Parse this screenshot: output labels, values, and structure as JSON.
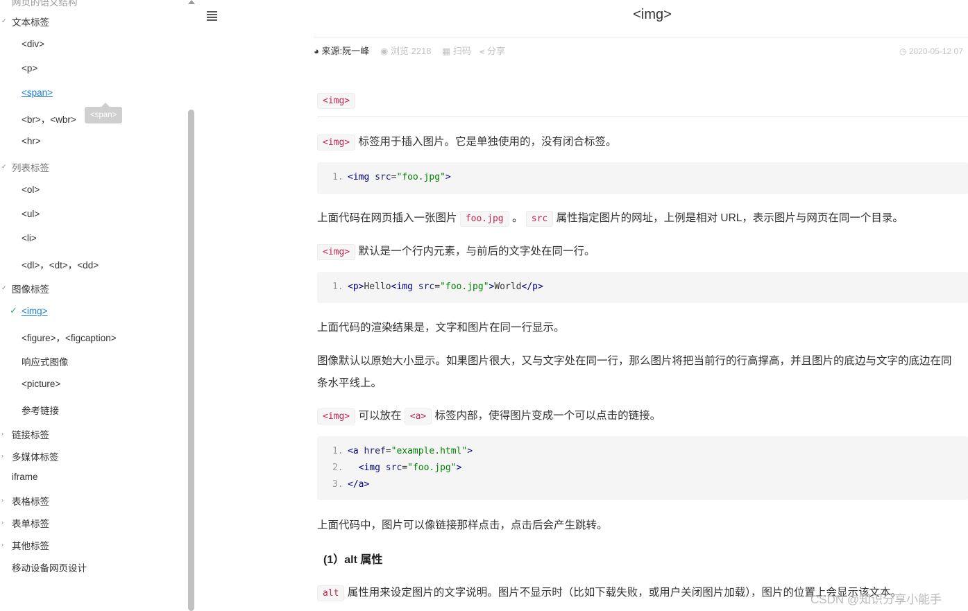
{
  "sidebar": {
    "top_cut": "网页的语义结构",
    "items": [
      {
        "label": "文本标签",
        "type": "cat",
        "caret": "✓"
      },
      {
        "label": "<div>",
        "type": "sub"
      },
      {
        "label": "<p>",
        "type": "sub"
      },
      {
        "label": "<span>",
        "type": "sub",
        "active": true
      },
      {
        "label": "<br>，<wbr>",
        "type": "sub"
      },
      {
        "label": "<hr>",
        "type": "sub"
      },
      {
        "label": "列表标签",
        "type": "cat",
        "muted": true
      },
      {
        "label": "<ol>",
        "type": "sub"
      },
      {
        "label": "<ul>",
        "type": "sub"
      },
      {
        "label": "<li>",
        "type": "sub"
      },
      {
        "label": "<dl>，<dt>，<dd>",
        "type": "sub"
      },
      {
        "label": "图像标签",
        "type": "cat"
      },
      {
        "label": "<img>",
        "type": "sub",
        "active": true,
        "checked": true
      },
      {
        "label": "<figure>，<figcaption>",
        "type": "sub"
      },
      {
        "label": "响应式图像",
        "type": "sub"
      },
      {
        "label": "<picture>",
        "type": "sub"
      },
      {
        "label": "参考链接",
        "type": "sub"
      },
      {
        "label": "链接标签",
        "type": "cat"
      },
      {
        "label": "多媒体标签",
        "type": "cat"
      },
      {
        "label": "iframe",
        "type": "cat"
      },
      {
        "label": "表格标签",
        "type": "cat"
      },
      {
        "label": "表单标签",
        "type": "cat"
      },
      {
        "label": "其他标签",
        "type": "cat"
      },
      {
        "label": "移动设备网页设计",
        "type": "cat"
      }
    ],
    "tooltip": "<span>"
  },
  "header": {
    "title": "<img>",
    "source": "来源:阮一峰",
    "views": "浏览 2218",
    "scan": "扫码",
    "share": "分享",
    "date": "2020-05-12 07"
  },
  "content": {
    "heading_tag": "<img>",
    "p1_code": "<img>",
    "p1_text": "标签用于插入图片。它是单独使用的，没有闭合标签。",
    "code1": [
      "<img src=\"foo.jpg\">"
    ],
    "p2_a": "上面代码在网页插入一张图片",
    "p2_code1": "foo.jpg",
    "p2_b": "。",
    "p2_code2": "src",
    "p2_c": "属性指定图片的网址，上例是相对 URL，表示图片与网页在同一个目录。",
    "p3_code": "<img>",
    "p3_text": "默认是一个行内元素，与前后的文字处在同一行。",
    "code2": [
      "<p>Hello<img src=\"foo.jpg\">World</p>"
    ],
    "p4": "上面代码的渲染结果是，文字和图片在同一行显示。",
    "p5_line1": "图像默认以原始大小显示。如果图片很大，又与文字处在同一行，那么图片将把当前行的行高撑高，并且图片的底边与文字的底边在同",
    "p5_line2": "条水平线上。",
    "p6_code1": "<img>",
    "p6_a": "可以放在",
    "p6_code2": "<a>",
    "p6_b": "标签内部，使得图片变成一个可以点击的链接。",
    "code3": [
      "<a href=\"example.html\">",
      "  <img src=\"foo.jpg\">",
      "</a>"
    ],
    "p7": "上面代码中，图片可以像链接那样点击，点击后会产生跳转。",
    "subhead": "(1）alt 属性",
    "p8_code": "alt",
    "p8_text": "属性用来设定图片的文字说明。图片不显示时（比如下载失败，或用户关闭图片加载），图片的位置上会显示该文本。"
  },
  "watermark": "CSDN @知识分享小能手"
}
